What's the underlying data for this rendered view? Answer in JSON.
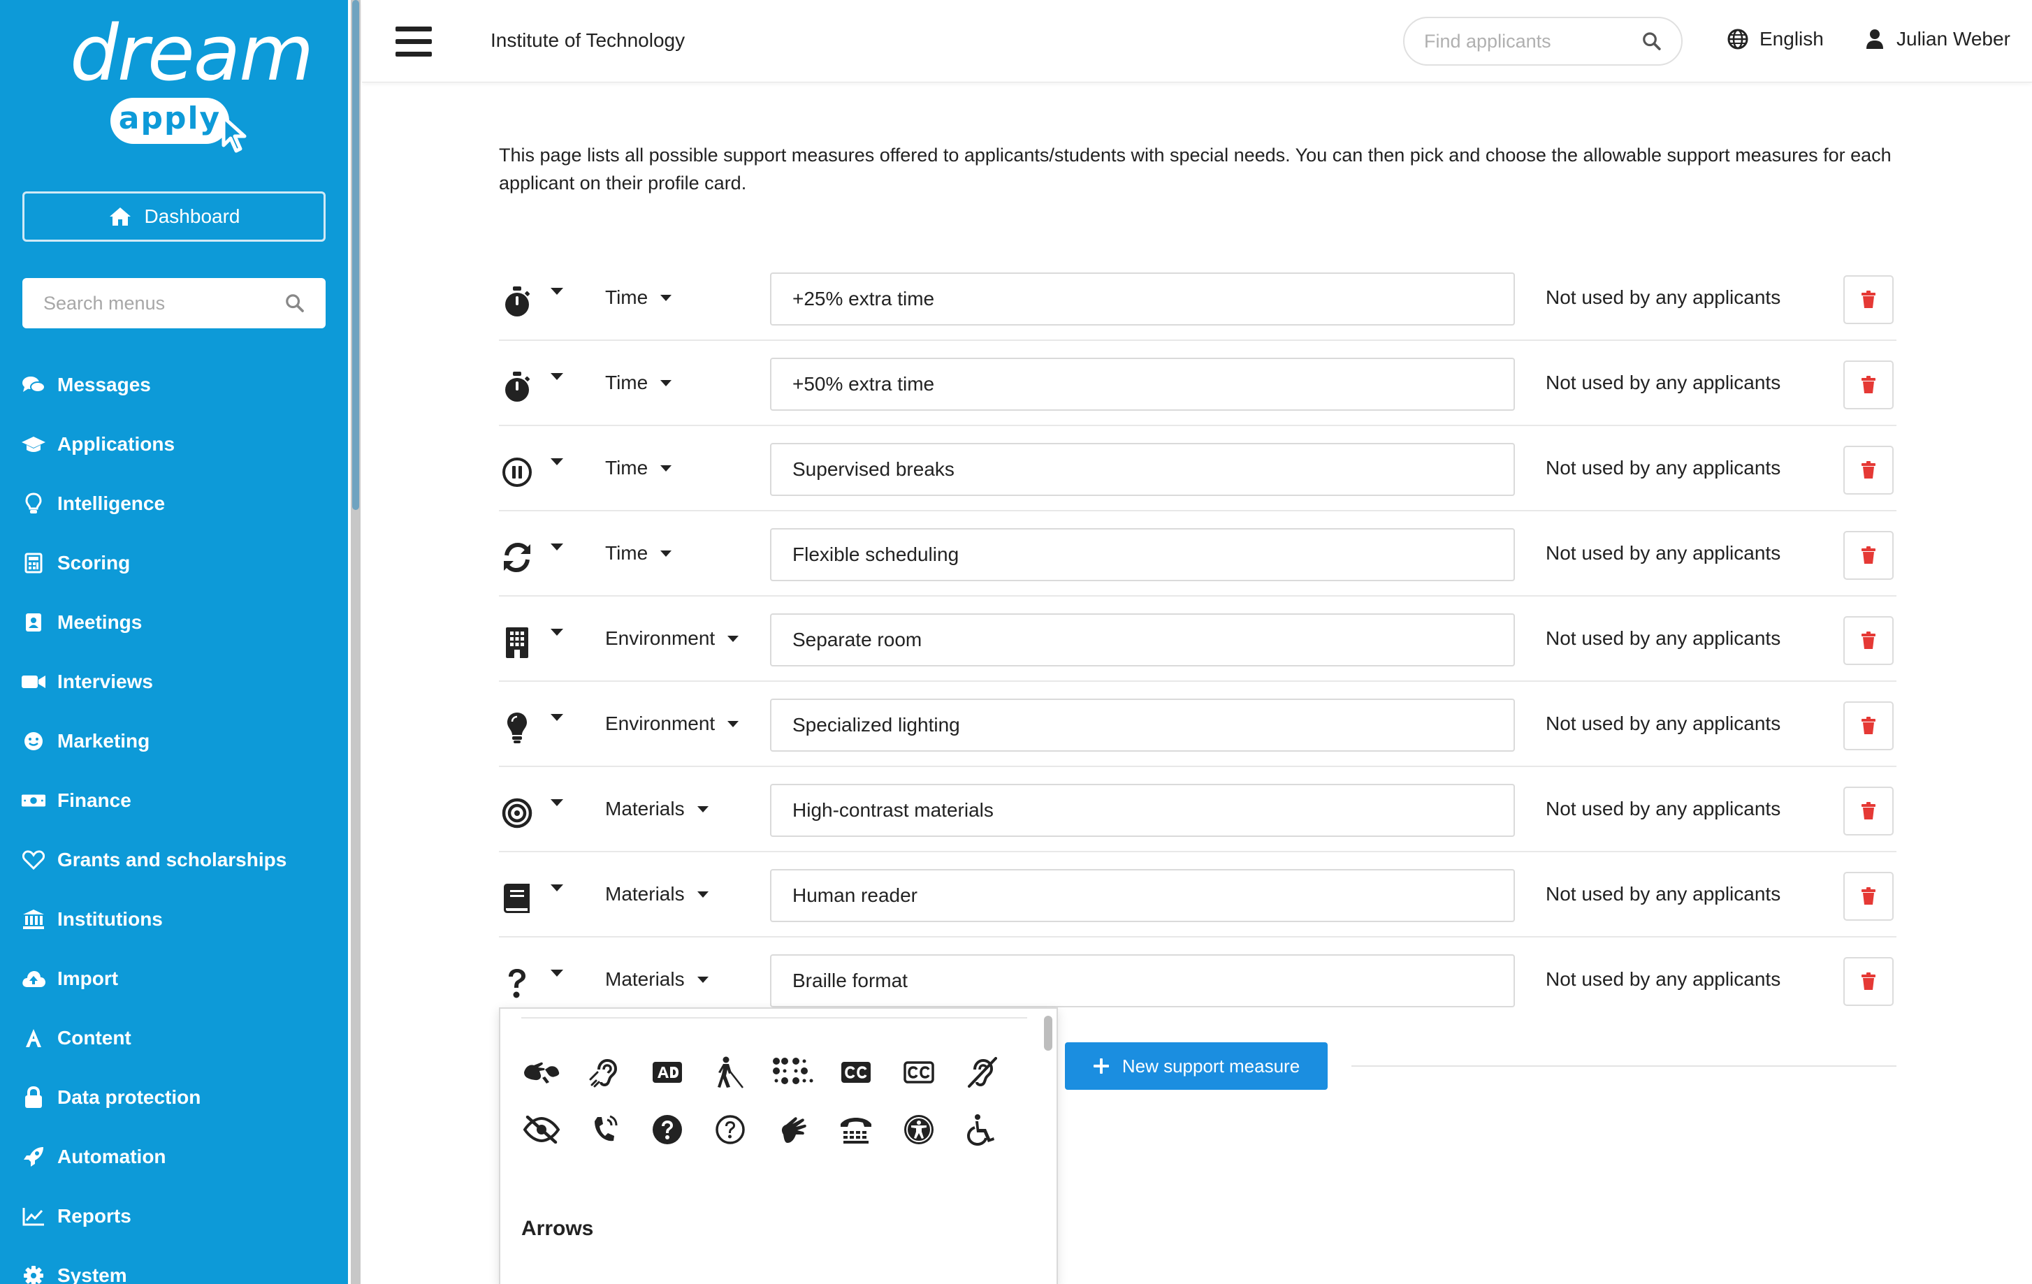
{
  "app": {
    "logo_text": "dream",
    "logo_sub": "apply"
  },
  "sidebar": {
    "dashboard_label": "Dashboard",
    "search_placeholder": "Search menus",
    "items": [
      {
        "label": "Messages",
        "icon": "comments-icon"
      },
      {
        "label": "Applications",
        "icon": "graduation-cap-icon"
      },
      {
        "label": "Intelligence",
        "icon": "lightbulb-icon"
      },
      {
        "label": "Scoring",
        "icon": "calculator-icon"
      },
      {
        "label": "Meetings",
        "icon": "contact-card-icon"
      },
      {
        "label": "Interviews",
        "icon": "video-camera-icon"
      },
      {
        "label": "Marketing",
        "icon": "smile-icon"
      },
      {
        "label": "Finance",
        "icon": "money-bill-icon"
      },
      {
        "label": "Grants and scholarships",
        "icon": "heart-icon"
      },
      {
        "label": "Institutions",
        "icon": "university-icon"
      },
      {
        "label": "Import",
        "icon": "cloud-upload-icon"
      },
      {
        "label": "Content",
        "icon": "font-icon"
      },
      {
        "label": "Data protection",
        "icon": "lock-icon"
      },
      {
        "label": "Automation",
        "icon": "rocket-icon"
      },
      {
        "label": "Reports",
        "icon": "chart-line-icon"
      },
      {
        "label": "System",
        "icon": "gear-icon"
      }
    ]
  },
  "header": {
    "institution": "Institute of Technology",
    "find_placeholder": "Find applicants",
    "language": "English",
    "user": "Julian Weber"
  },
  "main": {
    "intro": "This page lists all possible support measures offered to applicants/students with special needs. You can then pick and choose the allowable support measures for each applicant on their profile card.",
    "measures": [
      {
        "icon": "stopwatch-icon",
        "category": "Time",
        "name": "+25% extra time",
        "usage": "Not used by any applicants"
      },
      {
        "icon": "stopwatch-icon",
        "category": "Time",
        "name": "+50% extra time",
        "usage": "Not used by any applicants"
      },
      {
        "icon": "pause-circle-icon",
        "category": "Time",
        "name": "Supervised breaks",
        "usage": "Not used by any applicants"
      },
      {
        "icon": "sync-icon",
        "category": "Time",
        "name": "Flexible scheduling",
        "usage": "Not used by any applicants"
      },
      {
        "icon": "building-icon",
        "category": "Environment",
        "name": "Separate room",
        "usage": "Not used by any applicants"
      },
      {
        "icon": "lightbulb-icon",
        "category": "Environment",
        "name": "Specialized lighting",
        "usage": "Not used by any applicants"
      },
      {
        "icon": "bullseye-icon",
        "category": "Materials",
        "name": "High-contrast materials",
        "usage": "Not used by any applicants"
      },
      {
        "icon": "book-icon",
        "category": "Materials",
        "name": "Human reader",
        "usage": "Not used by any applicants"
      },
      {
        "icon": "question-icon",
        "category": "Materials",
        "name": "Braille format",
        "usage": "Not used by any applicants"
      }
    ],
    "new_button": "New support measure"
  },
  "picker": {
    "icons": [
      "sign-language-interpreting-icon",
      "assistive-listening-icon",
      "audio-description-icon",
      "blind-icon",
      "braille-icon",
      "closed-captioning-icon",
      "closed-captioning-outline-icon",
      "deaf-icon",
      "low-vision-icon",
      "volume-control-phone-icon",
      "question-circle-icon",
      "question-circle-outline-icon",
      "sign-language-icon",
      "tty-icon",
      "universal-access-icon",
      "wheelchair-icon"
    ],
    "next_section": "Arrows"
  },
  "colors": {
    "sidebar": "#0d9ad8",
    "primary_button": "#1b8ee0",
    "delete": "#e53935"
  }
}
